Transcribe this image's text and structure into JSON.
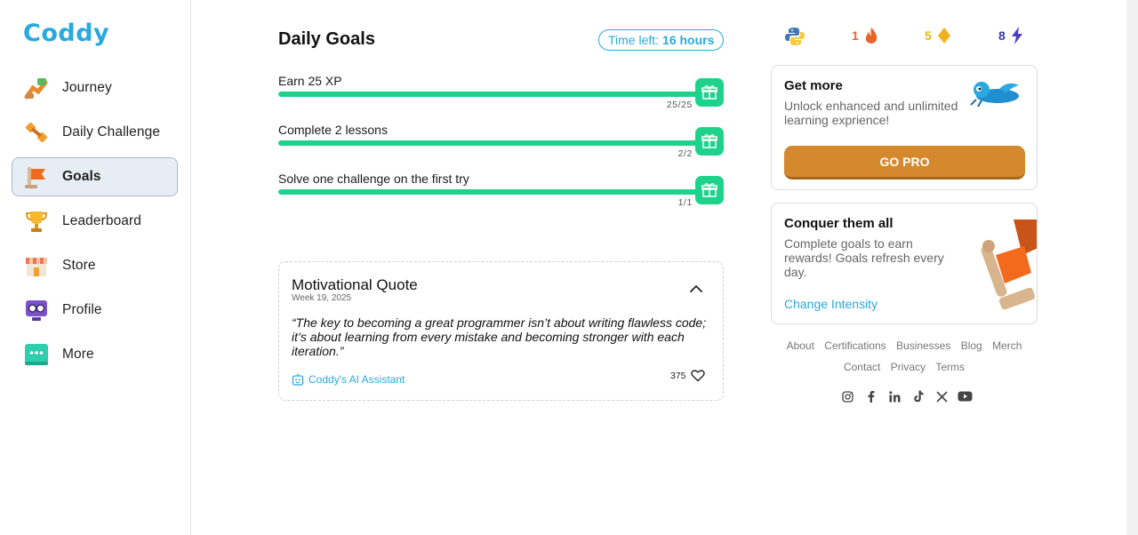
{
  "app": {
    "logo_text": "Coddy"
  },
  "sidebar": {
    "items": [
      {
        "label": "Journey",
        "icon": "journey-icon",
        "active": false
      },
      {
        "label": "Daily Challenge",
        "icon": "dumbbell-icon",
        "active": false
      },
      {
        "label": "Goals",
        "icon": "flag-icon",
        "active": true
      },
      {
        "label": "Leaderboard",
        "icon": "trophy-icon",
        "active": false
      },
      {
        "label": "Store",
        "icon": "store-icon",
        "active": false
      },
      {
        "label": "Profile",
        "icon": "profile-icon",
        "active": false
      },
      {
        "label": "More",
        "icon": "more-icon",
        "active": false
      }
    ]
  },
  "goals": {
    "title": "Daily Goals",
    "time_left_prefix": "Time left:",
    "time_left_value": "16 hours",
    "items": [
      {
        "label": "Earn 25 XP",
        "count": "25/25",
        "progress": 1.0
      },
      {
        "label": "Complete 2 lessons",
        "count": "2/2",
        "progress": 1.0
      },
      {
        "label": "Solve one challenge on the first try",
        "count": "1/1",
        "progress": 1.0
      }
    ]
  },
  "quote": {
    "title": "Motivational Quote",
    "week": "Week 19, 2025",
    "text": "“The key to becoming a great programmer isn’t about writing flawless code; it’s about learning from every mistake and becoming stronger with each iteration.”",
    "source": "Coddy's AI Assistant",
    "likes": "375"
  },
  "stats": {
    "language_icon": "python-icon",
    "streak": "1",
    "gems": "5",
    "energy": "8"
  },
  "promo_pro": {
    "title": "Get more",
    "description": "Unlock enhanced and unlimited learning exprience!",
    "button": "GO PRO"
  },
  "promo_goals": {
    "title": "Conquer them all",
    "description": "Complete goals to earn rewards! Goals refresh every day.",
    "link": "Change Intensity"
  },
  "footer": {
    "links": [
      "About",
      "Certifications",
      "Businesses",
      "Blog",
      "Merch",
      "Contact",
      "Privacy",
      "Terms"
    ],
    "socials": [
      "instagram-icon",
      "facebook-icon",
      "linkedin-icon",
      "tiktok-icon",
      "x-icon",
      "youtube-icon"
    ]
  },
  "colors": {
    "accent": "#29a9e0",
    "progress": "#1ed28b",
    "pro_button": "#d4892c",
    "streak": "#e8632a",
    "gems": "#f0b21c",
    "energy": "#3c3aa8"
  }
}
